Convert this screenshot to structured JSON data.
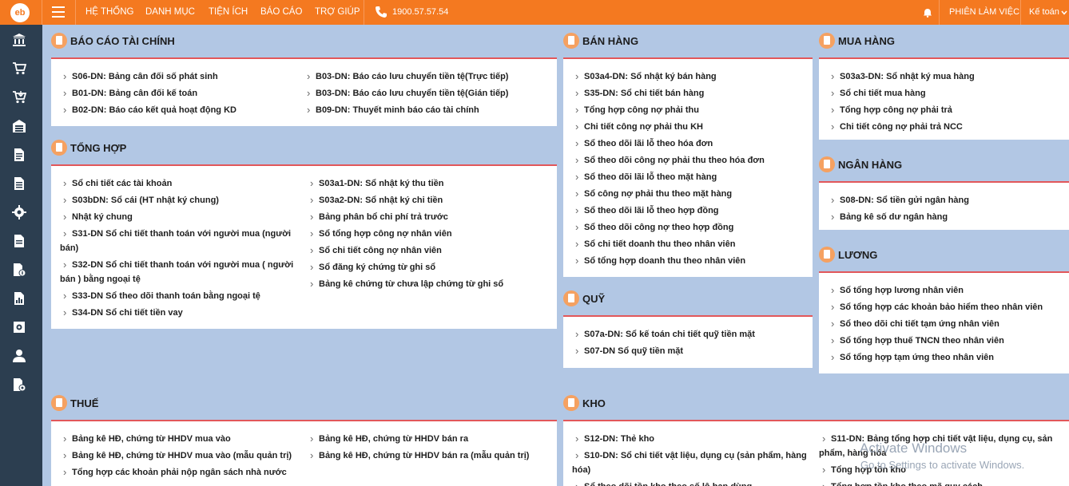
{
  "topbar": {
    "logo": "eb",
    "menu": [
      "HỆ THỐNG",
      "DANH MỤC",
      "TIỆN ÍCH",
      "BÁO CÁO",
      "TRỢ GIÚP"
    ],
    "phone": "1900.57.57.54",
    "session": "PHIÊN LÀM VIỆC",
    "user": "Kế toán"
  },
  "sidebar": {
    "icons": [
      "bank-icon",
      "cart-icon",
      "cart-download-icon",
      "warehouse-icon",
      "documents-icon",
      "document-list-icon",
      "gear-icon",
      "document-icon",
      "document-money-icon",
      "document-report-icon",
      "safe-icon",
      "user-icon",
      "settings-document-icon"
    ]
  },
  "sections": {
    "bctc": {
      "title": "BÁO CÁO TÀI CHÍNH",
      "left": [
        "S06-DN: Bảng cân đối số phát sinh",
        "B01-DN: Bảng cân đối kế toán",
        "B02-DN: Báo cáo kết quả hoạt động KD"
      ],
      "right": [
        "B03-DN: Báo cáo lưu chuyển tiền tệ(Trực tiếp)",
        "B03-DN: Báo cáo lưu chuyển tiền tệ(Gián tiếp)",
        "B09-DN: Thuyết minh báo cáo tài chính"
      ]
    },
    "tonghop": {
      "title": "TỔNG HỢP",
      "left": [
        "Sổ chi tiết các tài khoản",
        "S03bDN: Sổ cái (HT nhật ký chung)",
        "Nhật ký chung",
        "S31-DN Sổ chi tiết thanh toán với người mua (người",
        "bán)",
        "S32-DN Sổ chi tiết thanh toán với người mua ( người",
        "bán ) bằng ngoại tệ",
        "S33-DN Sổ theo dõi thanh toán bằng ngoại tệ",
        "S34-DN Sổ chi tiết tiền vay"
      ],
      "right": [
        "S03a1-DN: Sổ nhật ký thu tiền",
        "S03a2-DN: Sổ nhật ký chi tiền",
        "Bảng phân bổ chi phí trả trước",
        "Sổ tổng hợp công nợ nhân viên",
        "Sổ chi tiết công nợ nhân viên",
        "Sổ đăng ký chứng từ ghi sổ",
        "Bảng kê chứng từ chưa lập chứng từ ghi sổ"
      ]
    },
    "banhang": {
      "title": "BÁN HÀNG",
      "items": [
        "S03a4-DN: Sổ nhật ký bán hàng",
        "S35-DN: Sổ chi tiết bán hàng",
        "Tổng hợp công nợ phải thu",
        "Chi tiết công nợ phải thu KH",
        "Sổ theo dõi lãi lỗ theo hóa đơn",
        "Sổ theo dõi công nợ phải thu theo hóa đơn",
        "Sổ theo dõi lãi lỗ theo mặt hàng",
        "Sổ công nợ phải thu theo mặt hàng",
        "Sổ theo dõi lãi lỗ theo hợp đồng",
        "Sổ theo dõi công nợ theo hợp đồng",
        "Sổ chi tiết doanh thu theo nhân viên",
        "Sổ tổng hợp doanh thu theo nhân viên"
      ]
    },
    "muahang": {
      "title": "MUA HÀNG",
      "items": [
        "S03a3-DN: Sổ nhật ký mua hàng",
        "Sổ chi tiết mua hàng",
        "Tổng hợp công nợ phải trả",
        "Chi tiết công nợ phải trả NCC"
      ]
    },
    "nganhang": {
      "title": "NGÂN HÀNG",
      "items": [
        "S08-DN: Sổ tiền gửi ngân hàng",
        "Bảng kê số dư ngân hàng"
      ]
    },
    "luong": {
      "title": "LƯƠNG",
      "items": [
        "Sổ tổng hợp lương nhân viên",
        "Sổ tổng hợp các khoản bảo hiểm theo nhân viên",
        "Sổ theo dõi chi tiết tạm ứng nhân viên",
        "Sổ tổng hợp thuế TNCN theo nhân viên",
        "Sổ tổng hợp tạm ứng theo nhân viên"
      ]
    },
    "quy": {
      "title": "QUỸ",
      "items": [
        "S07a-DN: Sổ kế toán chi tiết quỹ tiền mặt",
        "S07-DN Sổ quỹ tiền mặt"
      ]
    },
    "thue": {
      "title": "THUẾ",
      "left": [
        "Bảng kê HĐ, chứng từ HHDV mua vào",
        "Bảng kê HĐ, chứng từ HHDV mua vào (mẫu quản trị)",
        "Tổng hợp các khoản phải nộp ngân sách nhà nước"
      ],
      "right": [
        "Bảng kê HĐ, chứng từ HHDV bán ra",
        "Bảng kê HĐ, chứng từ HHDV bán ra (mẫu quản trị)"
      ]
    },
    "kho": {
      "title": "KHO",
      "items": [
        "S12-DN: Thẻ kho",
        "S10-DN: Sổ chi tiết vật liệu, dụng cụ (sản phẩm, hàng",
        "hóa)",
        "Sổ theo dõi tồn kho theo số lô hạn dùng"
      ],
      "right": [
        "S11-DN: Bảng tổng hợp chi tiết vật liệu, dụng cụ, sản",
        "phẩm, hàng hóa",
        "Tổng hợp tồn kho",
        "Tổng hợp tồn kho theo mã quy cách"
      ]
    }
  },
  "watermark": {
    "line1": "Activate Windows",
    "line2": "Go to Settings to activate Windows."
  }
}
